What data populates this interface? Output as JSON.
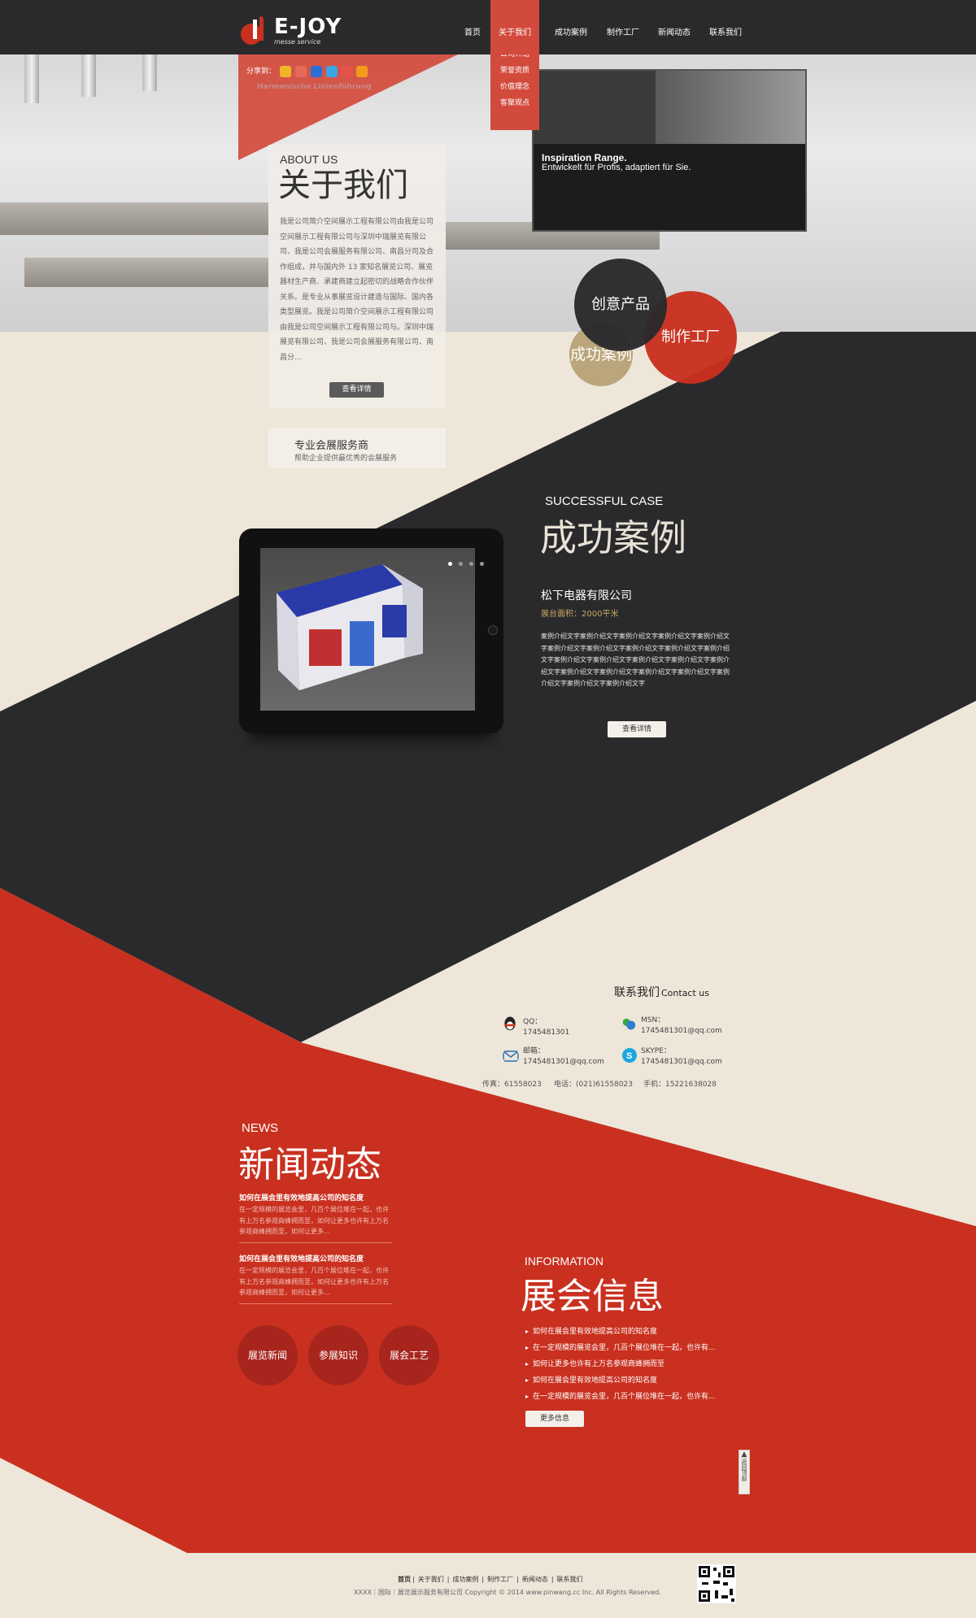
{
  "header": {
    "logo_text": "E-JOY",
    "logo_sub": "messe service",
    "nav": [
      "首页",
      "关于我们",
      "成功案例",
      "制作工厂",
      "新闻动态",
      "联系我们"
    ],
    "nav_active": "关于我们",
    "dropdown": [
      "公司介绍",
      "荣誉资质",
      "价值理念",
      "客聚观点"
    ]
  },
  "hero": {
    "share_label": "分享到：",
    "faint_text_1": "Harmonische Linienführung",
    "photo_title": "Inspiration Range.",
    "photo_sub": "Entwickelt für Profis, adaptiert für Sie."
  },
  "about": {
    "en": "ABOUT US",
    "cn": "关于我们",
    "text": "我是公司简介空间展示工程有限公司由我是公司空间展示工程有限公司与深圳中瑞展览有限公司、我是公司会展服务有限公司、南昌分司及合作组成，并与国内外 13 家知名展览公司、展览器材生产商、承建商建立起密切的战略合作伙伴关系。是专业从事展览设计建造与国际、国内各类型展览。我是公司简介空间展示工程有限公司由我是公司空间展示工程有限公司与。深圳中瑞展览有限公司、我是公司会展服务有限公司、南昌分...",
    "btn": "查看详情"
  },
  "pro": {
    "title": "专业会展服务商",
    "sub": "帮助企业提供最优秀的会展服务"
  },
  "circles": [
    "创意产品",
    "制作工厂",
    "成功案例"
  ],
  "case": {
    "en": "SUCCESSFUL CASE",
    "cn": "成功案例",
    "title": "松下电器有限公司",
    "area": "展台面积：2000平米",
    "desc": "案例介绍文字案例介绍文字案例介绍文字案例介绍文字案例介绍文字案例介绍文字案例介绍文字案例介绍文字案例介绍文字案例介绍文字案例介绍文字案例介绍文字案例介绍文字案例介绍文字案例介绍文字案例介绍文字案例介绍文字案例介绍文字案例介绍文字案例介绍文字案例介绍文字案例介绍文字",
    "btn": "查看详情"
  },
  "contact": {
    "title": "联系我们",
    "title_en": "Contact us",
    "qq_label": "QQ：",
    "qq": "1745481301",
    "msn_label": "MSN：",
    "msn": "1745481301@qq.com",
    "mail_label": "邮箱：",
    "mail": "1745481301@qq.com",
    "skype_label": "SKYPE：",
    "skype": "1745481301@qq.com",
    "fax": "传真：61558023",
    "phone": "电话：(021)61558023",
    "mobile": "手机：15221638028"
  },
  "news": {
    "en": "NEWS",
    "cn": "新闻动态",
    "items": [
      {
        "title": "如何在展会里有效地提高公司的知名度",
        "text": "在一定规模的展览会里，几百个展位堆在一起，也许有上万名参观商蜂拥而至，如何让更多也许有上万名参观商蜂拥而至，如何让更多..."
      },
      {
        "title": "如何在展会里有效地提高公司的知名度",
        "text": "在一定规模的展览会里，几百个展位堆在一起，也许有上万名参观商蜂拥而至，如何让更多也许有上万名参观商蜂拥而至，如何让更多..."
      }
    ],
    "circles": [
      "展览新闻",
      "参展知识",
      "展会工艺"
    ]
  },
  "info": {
    "en": "INFORMATION",
    "cn": "展会信息",
    "items": [
      "如何在展会里有效地提高公司的知名度",
      "在一定规模的展览会里，几百个展位堆在一起，也许有...",
      "如何让更多也许有上万名参观商蜂拥而至",
      "如何在展会里有效地提高公司的知名度",
      "在一定规模的展览会里，几百个展位堆在一起，也许有..."
    ],
    "btn": "更多信息"
  },
  "totop": "返回顶部",
  "footer": {
    "nav": [
      "首页",
      "关于我们",
      "成功案例",
      "制作工厂",
      "新闻动态",
      "联系我们"
    ],
    "copy": "XXXX｜国际｜展览展示服务有限公司  Copyright © 2014 www.pinwang.cc Inc. All Rights Reserved."
  },
  "colors": {
    "red": "#c9301f",
    "dark": "#2a2a2c",
    "beige": "#ede6d9",
    "gold": "#bba57a"
  }
}
